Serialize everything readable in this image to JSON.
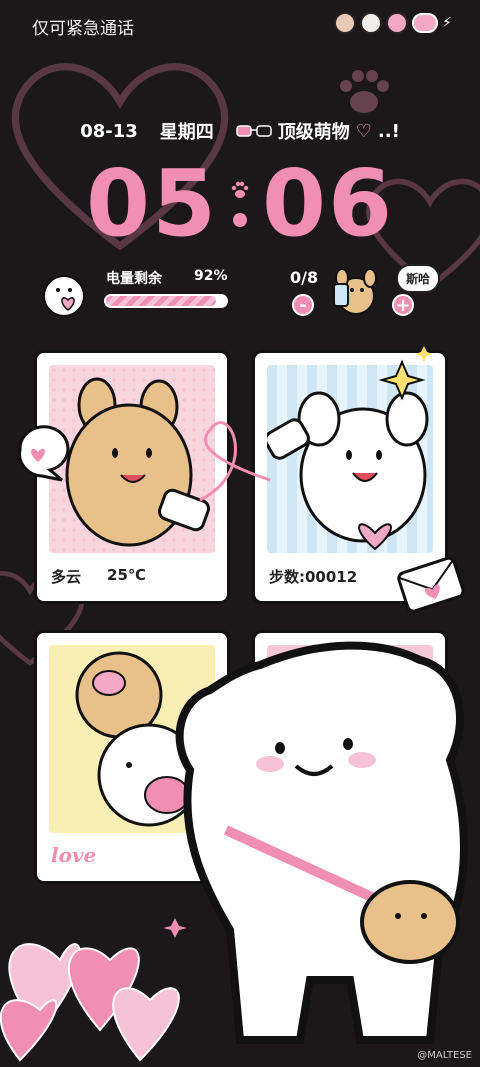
{
  "status_bar": {
    "carrier_text": "仅可紧急通话",
    "icons": [
      "dog-face-icon",
      "cow-face-icon",
      "bunny-face-icon",
      "heart-battery-icon",
      "charging-bolt-icon"
    ]
  },
  "date_line": {
    "date": "08-13",
    "weekday": "星期四",
    "mood_text": "顶级萌物",
    "mood_suffix": "..!"
  },
  "clock": {
    "hours": "05",
    "minutes": "06"
  },
  "battery_widget": {
    "label": "电量剩余",
    "percent_text": "92%",
    "level": 0.92
  },
  "counter_widget": {
    "count_text": "0/8",
    "minus_label": "-",
    "plus_label": "+",
    "bubble_text": "斯哈"
  },
  "cards": {
    "weather": {
      "condition": "多云",
      "temperature": "25℃"
    },
    "steps": {
      "label": "步数:00012"
    },
    "love": {
      "text": "love"
    }
  },
  "watermark": "@MALTESE",
  "colors": {
    "background": "#1c1718",
    "accent_pink": "#f08fb2",
    "light_pink": "#f7c2d5",
    "card_blue": "#cfe6f5",
    "card_yellow": "#f9efb4"
  }
}
